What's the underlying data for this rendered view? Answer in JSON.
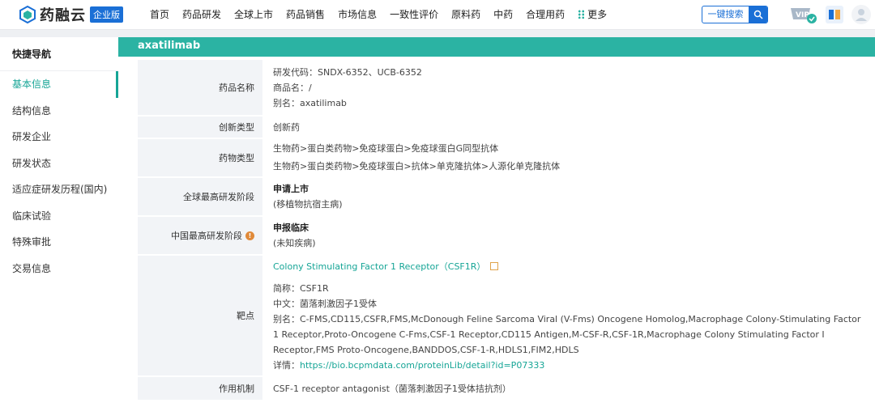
{
  "brand": {
    "name": "药融云",
    "badge": "企业版"
  },
  "nav": [
    "首页",
    "药品研发",
    "全球上市",
    "药品销售",
    "市场信息",
    "一致性评价",
    "原料药",
    "中药",
    "合理用药",
    "更多"
  ],
  "search": {
    "label": "一键搜索"
  },
  "vip_label": "VIP",
  "sidebar": {
    "title": "快捷导航",
    "items": [
      "基本信息",
      "结构信息",
      "研发企业",
      "研发状态",
      "适应症研发历程(国内)",
      "临床试验",
      "特殊审批",
      "交易信息"
    ]
  },
  "drug": {
    "title": "axatilimab",
    "labels": {
      "name": "药品名称",
      "innovation": "创新类型",
      "type": "药物类型",
      "global_stage": "全球最高研发阶段",
      "china_stage": "中国最高研发阶段",
      "target": "靶点",
      "mechanism": "作用机制"
    },
    "name_lines": [
      "研发代码：SNDX-6352、UCB-6352",
      "商品名：/",
      "别名：axatilimab"
    ],
    "innovation": "创新药",
    "type_lines": [
      "生物药>蛋白类药物>免疫球蛋白>免疫球蛋白G同型抗体",
      "生物药>蛋白类药物>免疫球蛋白>抗体>单克隆抗体>人源化单克隆抗体"
    ],
    "global_stage": {
      "stage": "申请上市",
      "note": "(移植物抗宿主病)"
    },
    "china_stage": {
      "stage": "申报临床",
      "note": "(未知疾病)"
    },
    "target": {
      "link": "Colony Stimulating Factor 1 Receptor（CSF1R）",
      "abbr": "简称：CSF1R",
      "chinese": "中文：菌落刺激因子1受体",
      "aliases": "别名：C-FMS,CD115,CSFR,FMS,McDonough Feline Sarcoma Viral (V-Fms) Oncogene Homolog,Macrophage Colony-Stimulating Factor 1 Receptor,Proto-Oncogene C-Fms,CSF-1 Receptor,CD115 Antigen,M-CSF-R,CSF-1R,Macrophage Colony Stimulating Factor I Receptor,FMS Proto-Oncogene,BANDDOS,CSF-1-R,HDLS1,FIM2,HDLS",
      "detail_label": "详情：",
      "detail_url": "https://bio.bcpmdata.com/proteinLib/detail?id=P07333"
    },
    "mechanism": "CSF-1 receptor antagonist（菌落刺激因子1受体拮抗剂）"
  },
  "colors": {
    "accent": "#2bb3a3",
    "brand_blue": "#1a6fd6",
    "link": "#16a596"
  }
}
